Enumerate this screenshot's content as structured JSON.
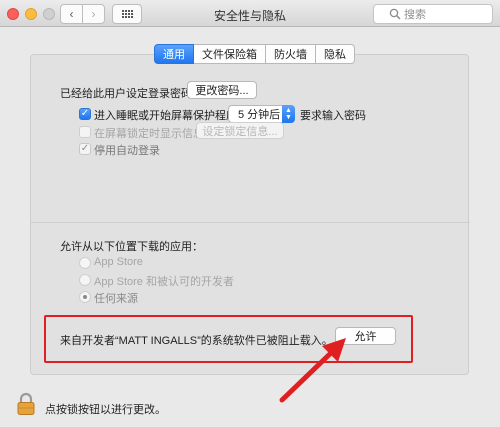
{
  "window": {
    "title": "安全性与隐私",
    "search_placeholder": "搜索"
  },
  "tabs": [
    {
      "label": "通用",
      "active": true
    },
    {
      "label": "文件保险箱",
      "active": false
    },
    {
      "label": "防火墙",
      "active": false
    },
    {
      "label": "隐私",
      "active": false
    }
  ],
  "general": {
    "password_label": "已经给此用户设定登录密码",
    "change_password_button": "更改密码...",
    "require_password": {
      "label": "进入睡眠或开始屏幕保护程序",
      "checked": true
    },
    "require_delay_value": "5 分钟后",
    "require_suffix": "要求输入密码",
    "show_message": {
      "label": "在屏幕锁定时显示信息",
      "checked": false
    },
    "set_lock_message_button": "设定锁定信息...",
    "disable_auto_login": {
      "label": "停用自动登录",
      "checked": true
    }
  },
  "downloads": {
    "heading": "允许从以下位置下载的应用：",
    "options": [
      {
        "label": "App Store",
        "selected": false
      },
      {
        "label": "App Store 和被认可的开发者",
        "selected": false
      },
      {
        "label": "任何来源",
        "selected": true
      }
    ],
    "blocked_message": "来自开发者“MATT INGALLS”的系统软件已被阻止载入。",
    "allow_button": "允许"
  },
  "footer": {
    "lock_text": "点按锁按钮以进行更改。"
  },
  "colors": {
    "accent": "#1f76ef",
    "annotation": "#e02020"
  }
}
